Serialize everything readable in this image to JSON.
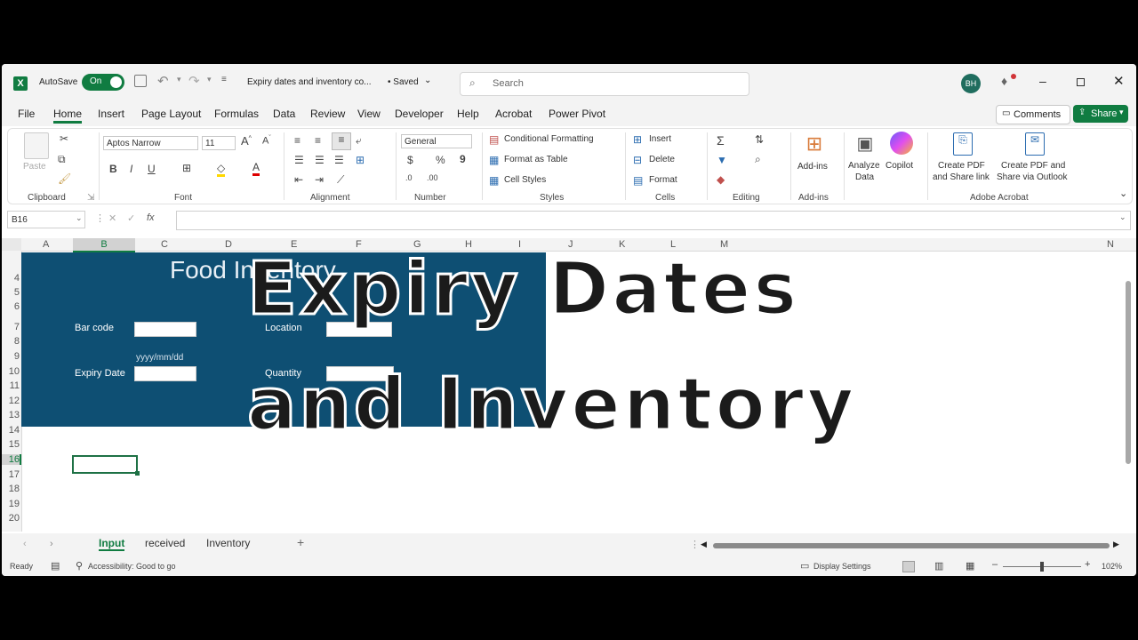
{
  "titlebar": {
    "autosave_label": "AutoSave",
    "autosave_state": "On",
    "document_title": "Expiry dates and inventory co...",
    "saved_label": "• Saved",
    "search_placeholder": "Search",
    "avatar_initials": "BH"
  },
  "menu": [
    "File",
    "Home",
    "Insert",
    "Page Layout",
    "Formulas",
    "Data",
    "Review",
    "View",
    "Developer",
    "Help",
    "Acrobat",
    "Power Pivot"
  ],
  "menu_active": "Home",
  "comments_label": "Comments",
  "share_label": "Share",
  "ribbon": {
    "clipboard": {
      "paste": "Paste",
      "group": "Clipboard"
    },
    "font": {
      "name": "Aptos Narrow",
      "size": "11",
      "group": "Font"
    },
    "alignment": {
      "group": "Alignment"
    },
    "number": {
      "format": "General",
      "group": "Number"
    },
    "styles": {
      "conditional": "Conditional Formatting",
      "format_table": "Format as Table",
      "cell_styles": "Cell Styles",
      "group": "Styles"
    },
    "cells": {
      "insert": "Insert",
      "delete": "Delete",
      "format": "Format",
      "group": "Cells"
    },
    "editing": {
      "group": "Editing"
    },
    "addins": {
      "label": "Add-ins",
      "group": "Add-ins"
    },
    "analyze": {
      "line1": "Analyze",
      "line2": "Data"
    },
    "copilot": "Copilot",
    "acrobat": {
      "create1_l1": "Create PDF",
      "create1_l2": "and Share link",
      "create2_l1": "Create PDF and",
      "create2_l2": "Share via Outlook",
      "group": "Adobe Acrobat"
    }
  },
  "formula_bar": {
    "name_box": "B16",
    "fx": "fx"
  },
  "columns": [
    "A",
    "B",
    "C",
    "D",
    "E",
    "F",
    "G",
    "H",
    "I",
    "J",
    "K",
    "L",
    "M",
    "N"
  ],
  "rows": [
    "4",
    "5",
    "6",
    "7",
    "8",
    "9",
    "10",
    "11",
    "12",
    "13",
    "14",
    "15",
    "16",
    "17",
    "18",
    "19",
    "20"
  ],
  "form": {
    "title": "Food Inventory",
    "bar_code": "Bar code",
    "location": "Location",
    "date_hint": "yyyy/mm/dd",
    "expiry_date": "Expiry Date",
    "quantity": "Quantity"
  },
  "overlay": {
    "line1": "Expiry Dates",
    "line2": "and Inventory"
  },
  "sheets": [
    "Input",
    "received",
    "Inventory"
  ],
  "active_sheet": "Input",
  "status": {
    "ready": "Ready",
    "accessibility": "Accessibility: Good to go",
    "display_settings": "Display Settings",
    "zoom": "102%"
  },
  "colors": {
    "excel_green": "#107c41",
    "form_blue": "#0e4f73"
  }
}
